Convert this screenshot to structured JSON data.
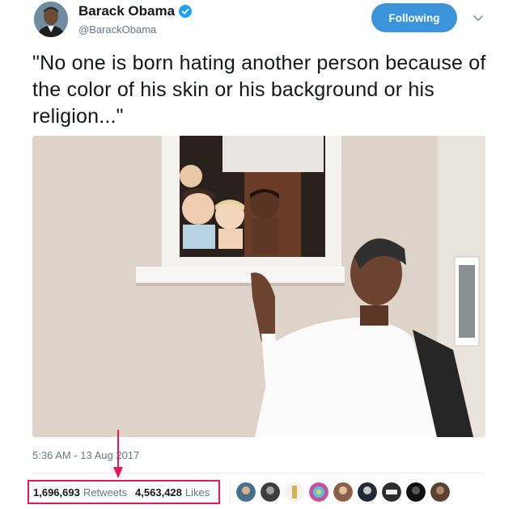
{
  "author": {
    "name": "Barack Obama",
    "handle": "@BarackObama",
    "verified_icon": "verified-badge-icon"
  },
  "follow_button": {
    "label": "Following"
  },
  "tweet": {
    "text": "\"No one is born hating another person because of the color of his skin or his background or his religion...\"",
    "timestamp": "5:36 AM - 13 Aug 2017"
  },
  "stats": {
    "retweets_count": "1,696,693",
    "retweets_label": "Retweets",
    "likes_count": "4,563,428",
    "likes_label": "Likes"
  },
  "likers": [
    "liker-avatar-1",
    "liker-avatar-2",
    "liker-avatar-3",
    "liker-avatar-4",
    "liker-avatar-5",
    "liker-avatar-6",
    "liker-avatar-7",
    "liker-avatar-8",
    "liker-avatar-9"
  ],
  "colors": {
    "follow_button_bg": "#3b94d9",
    "verified_blue": "#1da1f2",
    "highlight_box": "#e8175d",
    "secondary_text": "#657786"
  }
}
